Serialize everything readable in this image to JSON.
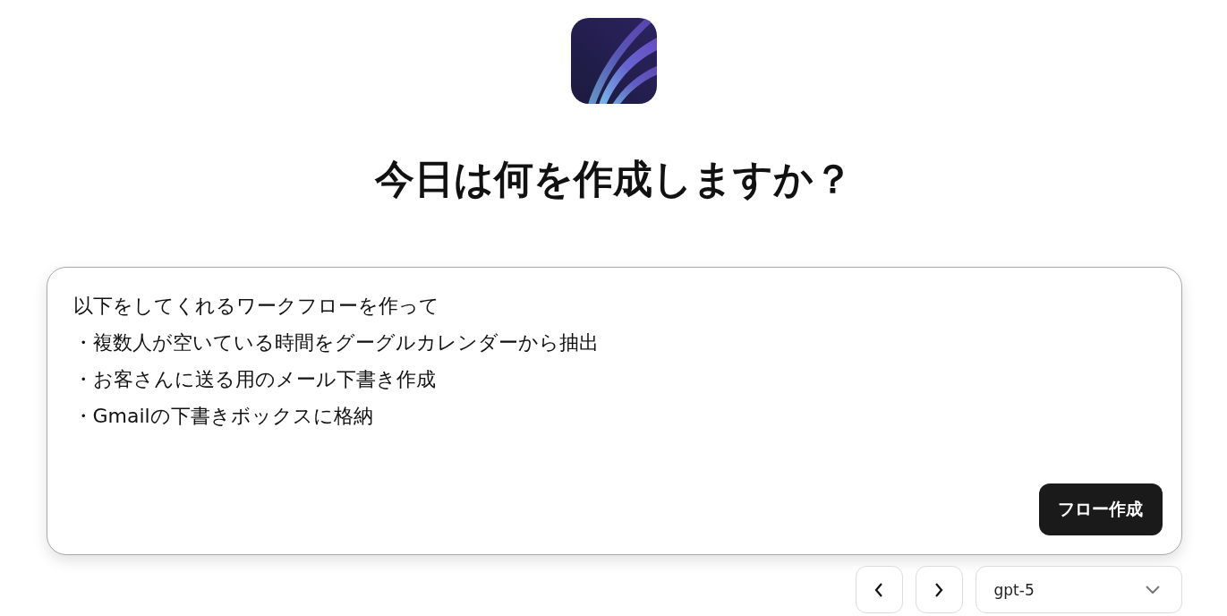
{
  "heading": "今日は何を作成しますか？",
  "prompt": {
    "lines": [
      "以下をしてくれるワークフローを作って",
      "・複数人が空いている時間をグーグルカレンダーから抽出",
      "・お客さんに送る用のメール下書き作成",
      "・Gmailの下書きボックスに格納"
    ]
  },
  "submit_button": "フロー作成",
  "model_select": {
    "value": "gpt-5"
  }
}
